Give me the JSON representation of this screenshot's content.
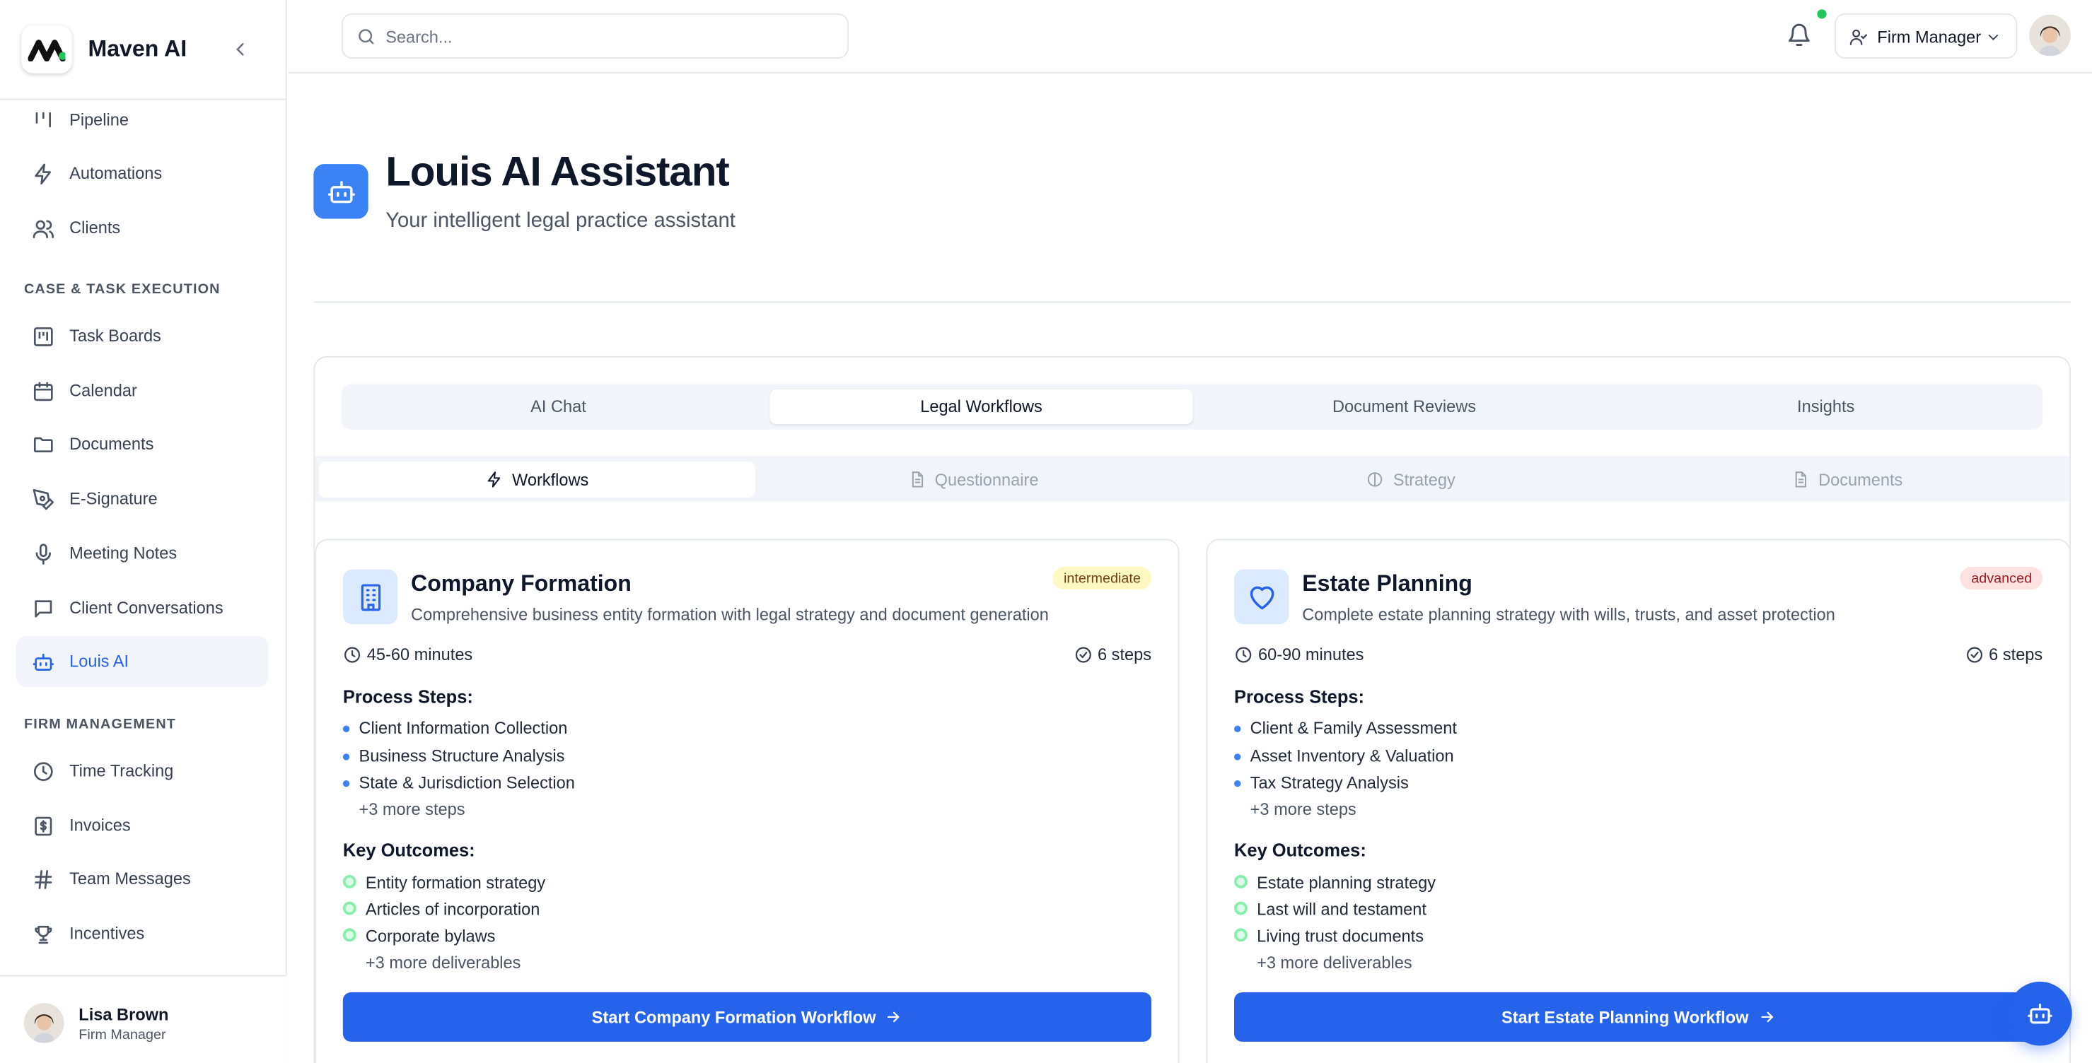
{
  "brand": {
    "name": "Maven AI"
  },
  "sidebar": {
    "items_top": [
      {
        "label": "Pipeline",
        "icon": "pipeline-icon"
      },
      {
        "label": "Automations",
        "icon": "zap-icon"
      },
      {
        "label": "Clients",
        "icon": "users-icon"
      }
    ],
    "section_case": "CASE & TASK EXECUTION",
    "items_case": [
      {
        "label": "Task Boards",
        "icon": "kanban-icon"
      },
      {
        "label": "Calendar",
        "icon": "calendar-icon"
      },
      {
        "label": "Documents",
        "icon": "folder-icon"
      },
      {
        "label": "E-Signature",
        "icon": "pen-icon"
      },
      {
        "label": "Meeting Notes",
        "icon": "mic-icon"
      },
      {
        "label": "Client Conversations",
        "icon": "message-icon"
      },
      {
        "label": "Louis AI",
        "icon": "bot-icon",
        "active": true
      }
    ],
    "section_firm": "FIRM MANAGEMENT",
    "items_firm": [
      {
        "label": "Time Tracking",
        "icon": "clock-icon"
      },
      {
        "label": "Invoices",
        "icon": "invoice-icon"
      },
      {
        "label": "Team Messages",
        "icon": "hash-icon"
      },
      {
        "label": "Incentives",
        "icon": "trophy-icon"
      }
    ],
    "user": {
      "name": "Lisa Brown",
      "role": "Firm Manager"
    }
  },
  "header": {
    "search_placeholder": "Search...",
    "role_label": "Firm Manager"
  },
  "page": {
    "title": "Louis AI Assistant",
    "subtitle": "Your intelligent legal practice assistant"
  },
  "tabs": [
    "AI Chat",
    "Legal Workflows",
    "Document Reviews",
    "Insights"
  ],
  "subtabs": [
    "Workflows",
    "Questionnaire",
    "Strategy",
    "Documents"
  ],
  "workflows": [
    {
      "title": "Company Formation",
      "description": "Comprehensive business entity formation with legal strategy and document generation",
      "level": "intermediate",
      "duration": "45-60 minutes",
      "steps_count": "6 steps",
      "process_title": "Process Steps:",
      "steps": [
        "Client Information Collection",
        "Business Structure Analysis",
        "State & Jurisdiction Selection"
      ],
      "more_steps": "+3 more steps",
      "outcomes_title": "Key Outcomes:",
      "outcomes": [
        "Entity formation strategy",
        "Articles of incorporation",
        "Corporate bylaws"
      ],
      "more_outcomes": "+3 more deliverables",
      "cta": "Start Company Formation Workflow"
    },
    {
      "title": "Estate Planning",
      "description": "Complete estate planning strategy with wills, trusts, and asset protection",
      "level": "advanced",
      "duration": "60-90 minutes",
      "steps_count": "6 steps",
      "process_title": "Process Steps:",
      "steps": [
        "Client & Family Assessment",
        "Asset Inventory & Valuation",
        "Tax Strategy Analysis"
      ],
      "more_steps": "+3 more steps",
      "outcomes_title": "Key Outcomes:",
      "outcomes": [
        "Estate planning strategy",
        "Last will and testament",
        "Living trust documents"
      ],
      "more_outcomes": "+3 more deliverables",
      "cta": "Start Estate Planning Workflow"
    }
  ],
  "colors": {
    "accent": "#2563eb",
    "intermediate_badge": "#fef9c3",
    "advanced_badge": "#fee2e2",
    "status_online": "#22c55e"
  }
}
